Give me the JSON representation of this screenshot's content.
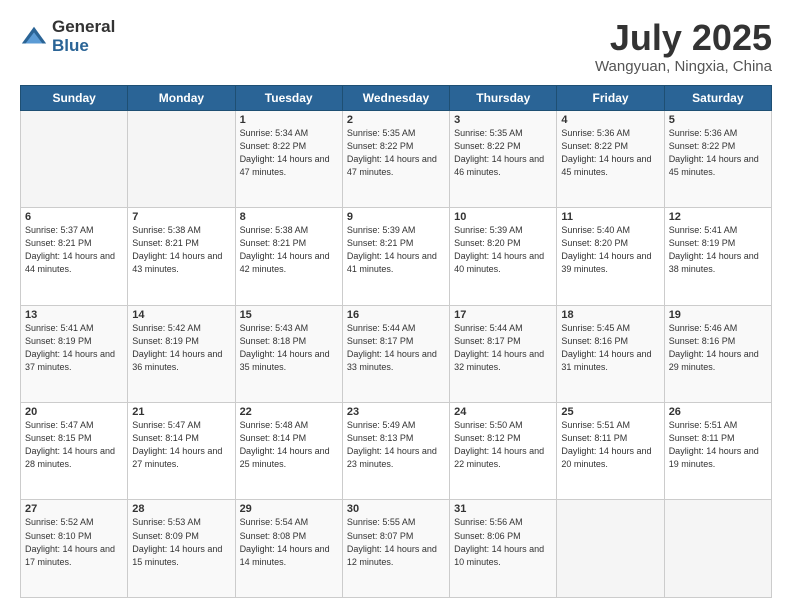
{
  "logo": {
    "general": "General",
    "blue": "Blue"
  },
  "title": {
    "month": "July 2025",
    "location": "Wangyuan, Ningxia, China"
  },
  "weekdays": [
    "Sunday",
    "Monday",
    "Tuesday",
    "Wednesday",
    "Thursday",
    "Friday",
    "Saturday"
  ],
  "weeks": [
    [
      {
        "day": "",
        "info": ""
      },
      {
        "day": "",
        "info": ""
      },
      {
        "day": "1",
        "info": "Sunrise: 5:34 AM\nSunset: 8:22 PM\nDaylight: 14 hours and 47 minutes."
      },
      {
        "day": "2",
        "info": "Sunrise: 5:35 AM\nSunset: 8:22 PM\nDaylight: 14 hours and 47 minutes."
      },
      {
        "day": "3",
        "info": "Sunrise: 5:35 AM\nSunset: 8:22 PM\nDaylight: 14 hours and 46 minutes."
      },
      {
        "day": "4",
        "info": "Sunrise: 5:36 AM\nSunset: 8:22 PM\nDaylight: 14 hours and 45 minutes."
      },
      {
        "day": "5",
        "info": "Sunrise: 5:36 AM\nSunset: 8:22 PM\nDaylight: 14 hours and 45 minutes."
      }
    ],
    [
      {
        "day": "6",
        "info": "Sunrise: 5:37 AM\nSunset: 8:21 PM\nDaylight: 14 hours and 44 minutes."
      },
      {
        "day": "7",
        "info": "Sunrise: 5:38 AM\nSunset: 8:21 PM\nDaylight: 14 hours and 43 minutes."
      },
      {
        "day": "8",
        "info": "Sunrise: 5:38 AM\nSunset: 8:21 PM\nDaylight: 14 hours and 42 minutes."
      },
      {
        "day": "9",
        "info": "Sunrise: 5:39 AM\nSunset: 8:21 PM\nDaylight: 14 hours and 41 minutes."
      },
      {
        "day": "10",
        "info": "Sunrise: 5:39 AM\nSunset: 8:20 PM\nDaylight: 14 hours and 40 minutes."
      },
      {
        "day": "11",
        "info": "Sunrise: 5:40 AM\nSunset: 8:20 PM\nDaylight: 14 hours and 39 minutes."
      },
      {
        "day": "12",
        "info": "Sunrise: 5:41 AM\nSunset: 8:19 PM\nDaylight: 14 hours and 38 minutes."
      }
    ],
    [
      {
        "day": "13",
        "info": "Sunrise: 5:41 AM\nSunset: 8:19 PM\nDaylight: 14 hours and 37 minutes."
      },
      {
        "day": "14",
        "info": "Sunrise: 5:42 AM\nSunset: 8:19 PM\nDaylight: 14 hours and 36 minutes."
      },
      {
        "day": "15",
        "info": "Sunrise: 5:43 AM\nSunset: 8:18 PM\nDaylight: 14 hours and 35 minutes."
      },
      {
        "day": "16",
        "info": "Sunrise: 5:44 AM\nSunset: 8:17 PM\nDaylight: 14 hours and 33 minutes."
      },
      {
        "day": "17",
        "info": "Sunrise: 5:44 AM\nSunset: 8:17 PM\nDaylight: 14 hours and 32 minutes."
      },
      {
        "day": "18",
        "info": "Sunrise: 5:45 AM\nSunset: 8:16 PM\nDaylight: 14 hours and 31 minutes."
      },
      {
        "day": "19",
        "info": "Sunrise: 5:46 AM\nSunset: 8:16 PM\nDaylight: 14 hours and 29 minutes."
      }
    ],
    [
      {
        "day": "20",
        "info": "Sunrise: 5:47 AM\nSunset: 8:15 PM\nDaylight: 14 hours and 28 minutes."
      },
      {
        "day": "21",
        "info": "Sunrise: 5:47 AM\nSunset: 8:14 PM\nDaylight: 14 hours and 27 minutes."
      },
      {
        "day": "22",
        "info": "Sunrise: 5:48 AM\nSunset: 8:14 PM\nDaylight: 14 hours and 25 minutes."
      },
      {
        "day": "23",
        "info": "Sunrise: 5:49 AM\nSunset: 8:13 PM\nDaylight: 14 hours and 23 minutes."
      },
      {
        "day": "24",
        "info": "Sunrise: 5:50 AM\nSunset: 8:12 PM\nDaylight: 14 hours and 22 minutes."
      },
      {
        "day": "25",
        "info": "Sunrise: 5:51 AM\nSunset: 8:11 PM\nDaylight: 14 hours and 20 minutes."
      },
      {
        "day": "26",
        "info": "Sunrise: 5:51 AM\nSunset: 8:11 PM\nDaylight: 14 hours and 19 minutes."
      }
    ],
    [
      {
        "day": "27",
        "info": "Sunrise: 5:52 AM\nSunset: 8:10 PM\nDaylight: 14 hours and 17 minutes."
      },
      {
        "day": "28",
        "info": "Sunrise: 5:53 AM\nSunset: 8:09 PM\nDaylight: 14 hours and 15 minutes."
      },
      {
        "day": "29",
        "info": "Sunrise: 5:54 AM\nSunset: 8:08 PM\nDaylight: 14 hours and 14 minutes."
      },
      {
        "day": "30",
        "info": "Sunrise: 5:55 AM\nSunset: 8:07 PM\nDaylight: 14 hours and 12 minutes."
      },
      {
        "day": "31",
        "info": "Sunrise: 5:56 AM\nSunset: 8:06 PM\nDaylight: 14 hours and 10 minutes."
      },
      {
        "day": "",
        "info": ""
      },
      {
        "day": "",
        "info": ""
      }
    ]
  ]
}
